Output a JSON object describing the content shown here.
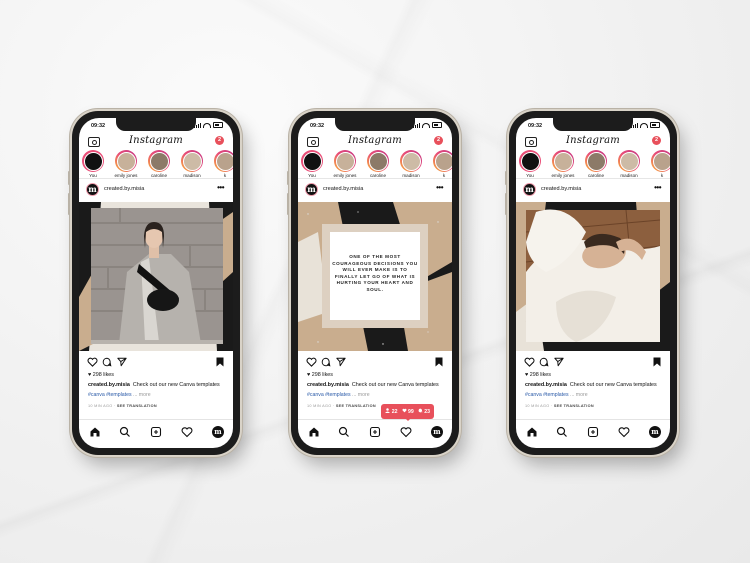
{
  "status_time": "09:32",
  "app_title": "Instagram",
  "notification_count": "2",
  "stories": [
    {
      "name": "You"
    },
    {
      "name": "emily jones"
    },
    {
      "name": "caroline"
    },
    {
      "name": "madison"
    },
    {
      "name": "k"
    }
  ],
  "post": {
    "avatar_letter": "m",
    "username": "created.by.misia",
    "more_label": "•••",
    "likes": "298 likes",
    "caption_user": "created.by.misia",
    "caption_text": "Check out our new Canva templates",
    "hashtags": "#canva #templates",
    "more_link": "... more",
    "time_ago": "10 MIN AGO",
    "see_translation": "SEE TRANSLATION"
  },
  "quote_text": "ONE OF THE MOST COURAGEOUS DECISIONS YOU WILL EVER MAKE IS TO FINALLY LET GO OF WHAT IS HURTING YOUR HEART AND SOUL.",
  "activity": {
    "followers": "22",
    "likes": "99",
    "comments": "23"
  },
  "colors": {
    "accent": "#e8505b",
    "hashtag": "#2a5aa8",
    "beige": "#c9ad8e",
    "black": "#1a1a1a"
  }
}
